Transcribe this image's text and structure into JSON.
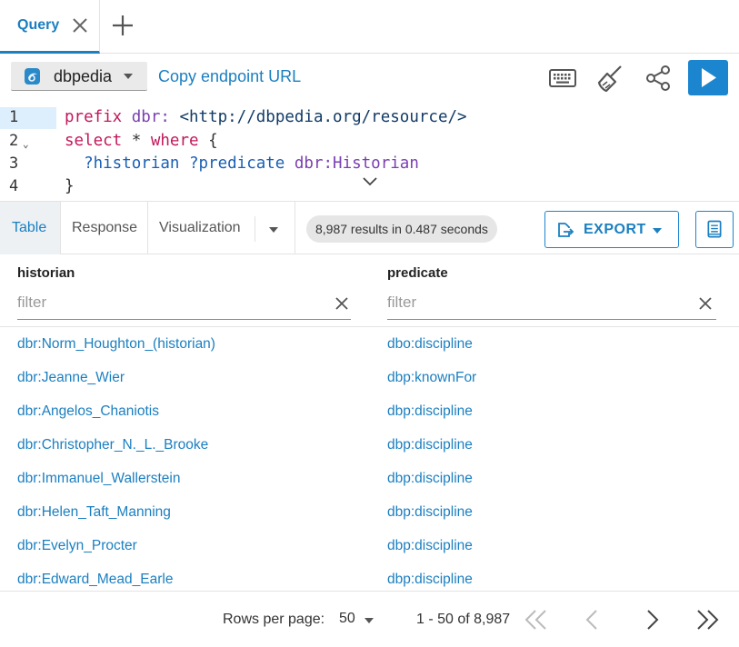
{
  "tabs": {
    "query_label": "Query"
  },
  "toolbar": {
    "endpoint_name": "dbpedia",
    "copy_endpoint_label": "Copy endpoint URL",
    "accent_color": "#1b86cf"
  },
  "editor": {
    "line_numbers": [
      "1",
      "2",
      "3",
      "4"
    ],
    "lines": {
      "l1_kw": "prefix",
      "l1_pfx": "dbr:",
      "l1_iri": "<http://dbpedia.org/resource/>",
      "l2_select": "select",
      "l2_star": "*",
      "l2_where": "where",
      "l2_brace": "{",
      "l3_v1": "?historian",
      "l3_v2": "?predicate",
      "l3_obj": "dbr:Historian",
      "l4_brace": "}"
    }
  },
  "results": {
    "tabs": [
      "Table",
      "Response",
      "Visualization"
    ],
    "summary": "8,987 results in 0.487 seconds",
    "export_label": "EXPORT"
  },
  "table": {
    "columns": [
      "historian",
      "predicate"
    ],
    "filter_placeholder": "filter",
    "rows": [
      [
        "dbr:Norm_Houghton_(historian)",
        "dbo:discipline"
      ],
      [
        "dbr:Jeanne_Wier",
        "dbp:knownFor"
      ],
      [
        "dbr:Angelos_Chaniotis",
        "dbp:discipline"
      ],
      [
        "dbr:Christopher_N._L._Brooke",
        "dbp:discipline"
      ],
      [
        "dbr:Immanuel_Wallerstein",
        "dbp:discipline"
      ],
      [
        "dbr:Helen_Taft_Manning",
        "dbp:discipline"
      ],
      [
        "dbr:Evelyn_Procter",
        "dbp:discipline"
      ],
      [
        "dbr:Edward_Mead_Earle",
        "dbp:discipline"
      ]
    ]
  },
  "footer": {
    "rows_per_page_label": "Rows per page:",
    "rows_per_page_value": "50",
    "range": "1 - 50 of 8,987"
  }
}
